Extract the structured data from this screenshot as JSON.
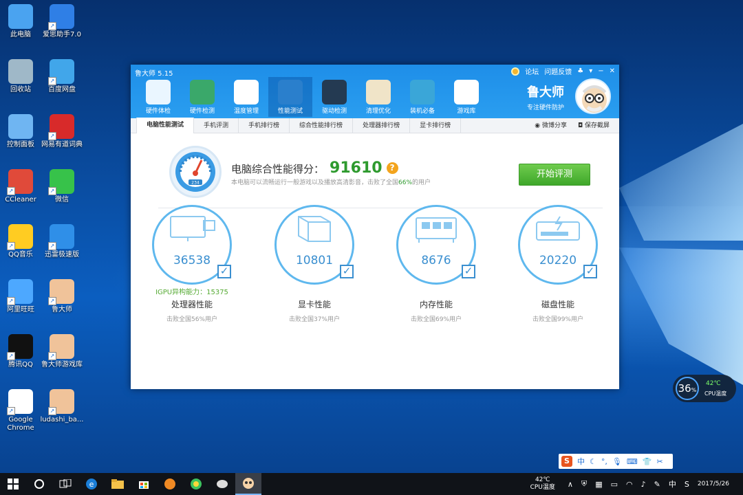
{
  "desktop": {
    "icons": [
      {
        "label": "此电脑",
        "icon": "computer-icon"
      },
      {
        "label": "爱思助手7.0",
        "icon": "i4-assistant-icon"
      },
      {
        "label": "回收站",
        "icon": "recycle-bin-icon"
      },
      {
        "label": "百度网盘",
        "icon": "baidu-netdisk-icon"
      },
      {
        "label": "控制面板",
        "icon": "control-panel-icon"
      },
      {
        "label": "网易有道词典",
        "icon": "youdao-dict-icon"
      },
      {
        "label": "CCleaner",
        "icon": "ccleaner-icon"
      },
      {
        "label": "微信",
        "icon": "wechat-icon"
      },
      {
        "label": "QQ音乐",
        "icon": "qq-music-icon"
      },
      {
        "label": "迅雷极速版",
        "icon": "xunlei-icon"
      },
      {
        "label": "阿里旺旺",
        "icon": "aliwangwang-icon"
      },
      {
        "label": "鲁大师",
        "icon": "ludashi-icon"
      },
      {
        "label": "腾讯QQ",
        "icon": "qq-icon"
      },
      {
        "label": "鲁大师游戏库",
        "icon": "ludashi-game-icon"
      },
      {
        "label": "Google Chrome",
        "icon": "chrome-icon"
      },
      {
        "label": "ludashi_ba...",
        "icon": "ludashi-installer-icon"
      }
    ]
  },
  "window": {
    "title": "鲁大师 5.15",
    "links": {
      "forum": "论坛",
      "feedback": "问题反馈"
    },
    "controls": {
      "minimize": "−",
      "close": "✕"
    },
    "tools": [
      {
        "label": "硬件体检",
        "icon": "monitor-icon"
      },
      {
        "label": "硬件检测",
        "icon": "chip-icon"
      },
      {
        "label": "温度管理",
        "icon": "thermometer-icon"
      },
      {
        "label": "性能测试",
        "icon": "speedometer-icon"
      },
      {
        "label": "驱动检测",
        "icon": "driver-gear-icon"
      },
      {
        "label": "清理优化",
        "icon": "broom-icon"
      },
      {
        "label": "装机必备",
        "icon": "apps-cube-icon"
      },
      {
        "label": "游戏库",
        "icon": "gamepad-icon"
      }
    ],
    "brand": {
      "name": "鲁大师",
      "slogan": "专注硬件防护"
    },
    "subtabs": [
      "电脑性能测试",
      "手机评测",
      "手机排行榜",
      "综合性能排行榜",
      "处理器排行榜",
      "显卡排行榜"
    ],
    "share": "微博分享",
    "save": "保存截屏"
  },
  "score": {
    "title": "电脑综合性能得分：",
    "value": "91610",
    "help": "?",
    "gauge_reading": "234",
    "desc_prefix": "本电脑可以流畅运行一般游戏以及播放高清影音，击败了全国",
    "beat_percent": "66%",
    "desc_suffix": "的用户",
    "button": "开始评测"
  },
  "cards": [
    {
      "score": "36538",
      "extra": "IGPU异构能力：15375",
      "name": "处理器性能",
      "beat": "击败全国56%用户",
      "icon": "cpu-monitor-icon"
    },
    {
      "score": "10801",
      "extra": "",
      "name": "显卡性能",
      "beat": "击败全国37%用户",
      "icon": "gpu-cube-icon"
    },
    {
      "score": "8676",
      "extra": "",
      "name": "内存性能",
      "beat": "击败全国69%用户",
      "icon": "memory-chip-icon"
    },
    {
      "score": "20220",
      "extra": "",
      "name": "磁盘性能",
      "beat": "击败全国99%用户",
      "icon": "disk-drive-icon"
    }
  ],
  "cpu_widget": {
    "percent": "36",
    "unit": "%",
    "temp": "42℃",
    "label": "CPU温度"
  },
  "taskbar": {
    "temp": "42℃",
    "temp_label": "CPU温度",
    "lang": "中",
    "date": "2017/5/26"
  }
}
